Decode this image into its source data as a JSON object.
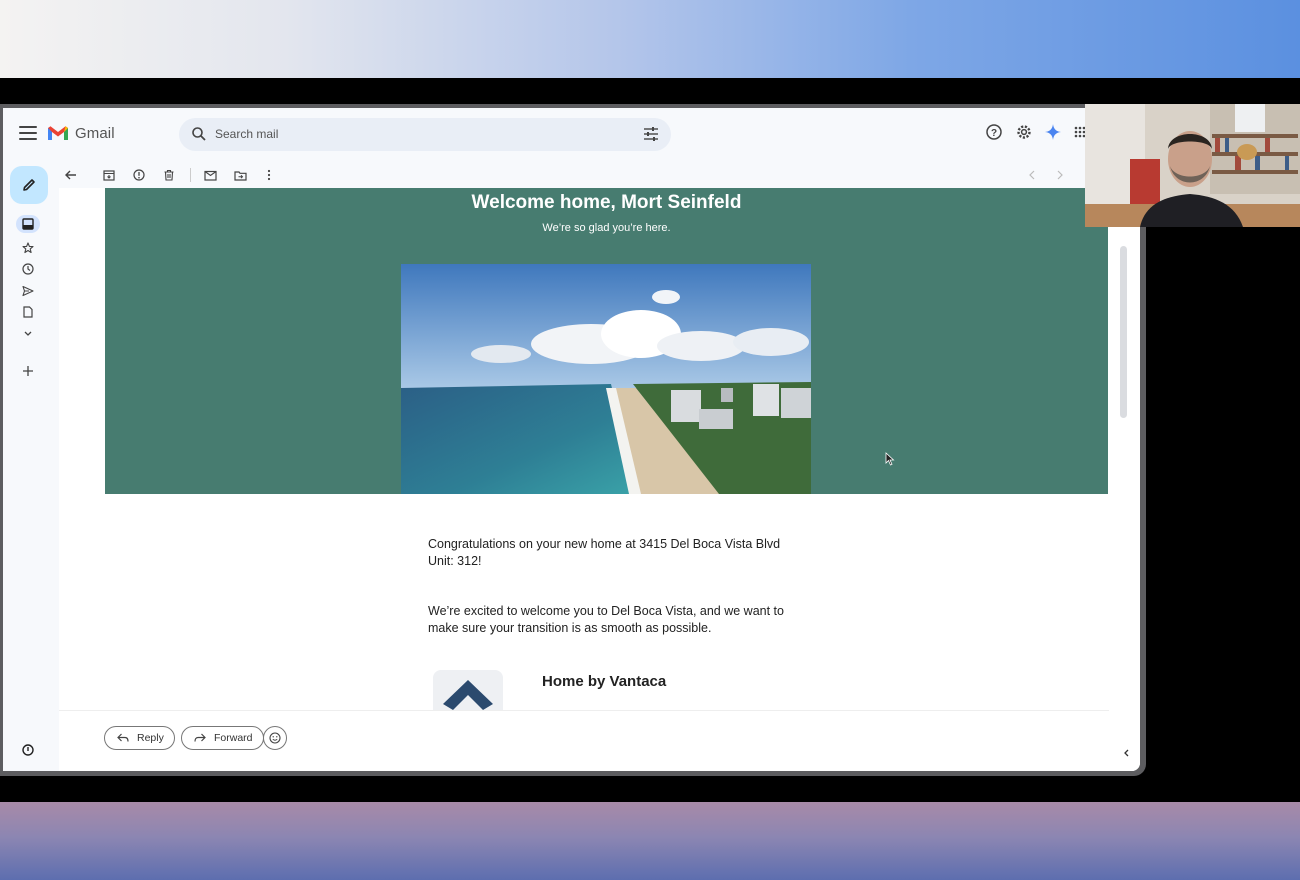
{
  "app": {
    "name": "Gmail"
  },
  "search": {
    "placeholder": "Search mail"
  },
  "header_icons": [
    "help-icon",
    "settings-icon",
    "gemini-icon",
    "apps-icon"
  ],
  "toolbar_icons": [
    "back-icon",
    "archive-icon",
    "report-spam-icon",
    "delete-icon",
    "mark-unread-icon",
    "move-to-icon",
    "more-icon"
  ],
  "sidebar_icons": [
    "compose-icon",
    "inbox-icon",
    "starred-icon",
    "snoozed-icon",
    "sent-icon",
    "drafts-icon",
    "more-chevron-icon",
    "new-label-icon"
  ],
  "email": {
    "hero_title": "Welcome home, Mort Seinfeld",
    "hero_subtitle": "We’re so glad you’re here.",
    "paragraph1": "Congratulations on your new home at 3415 Del Boca Vista Blvd Unit: 312!",
    "paragraph2": "We’re excited to welcome you to Del Boca Vista, and we want to make sure your transition is as smooth as possible.",
    "company_name": "Home by Vantaca"
  },
  "actions": {
    "reply": "Reply",
    "forward": "Forward"
  },
  "colors": {
    "hero_bg": "#477c70",
    "compose_bg": "#c2e7ff",
    "search_bg": "#e9eef6"
  }
}
